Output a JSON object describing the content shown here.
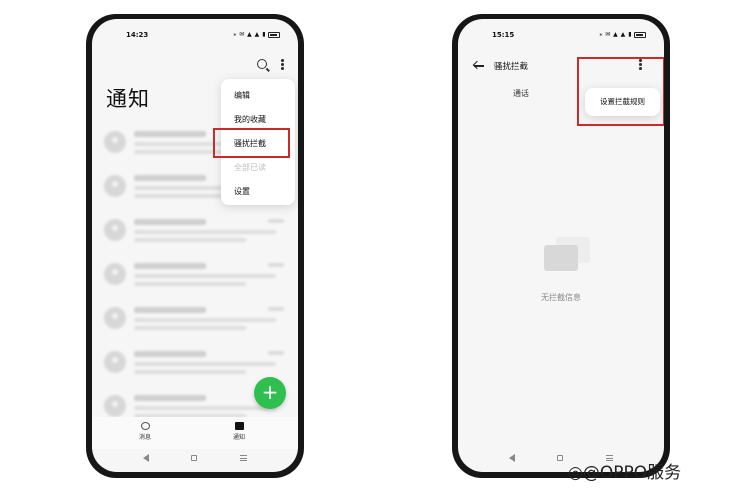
{
  "left_phone": {
    "status_time": "14:23",
    "status_icons": "⁎ ✉ ▲ ▲ ▮",
    "page_title": "通知",
    "menu": {
      "items": [
        {
          "label": "编辑",
          "disabled": false
        },
        {
          "label": "我的收藏",
          "disabled": false
        },
        {
          "label": "骚扰拦截",
          "disabled": false
        },
        {
          "label": "全部已读",
          "disabled": true
        },
        {
          "label": "设置",
          "disabled": false
        }
      ]
    },
    "fab_symbol": "+",
    "bottom_nav": {
      "messages_label": "消息",
      "notice_label": "通知"
    }
  },
  "right_phone": {
    "status_time": "15:15",
    "status_icons": "⁎ ✉ ▲ ▲ ▮",
    "header_title": "骚扰拦截",
    "tab_label": "通话",
    "popup_label": "设置拦截规则",
    "empty_text": "无拦截信息"
  },
  "watermark": "◎@OPPO服务",
  "colors": {
    "highlight": "#c92a2a",
    "fab": "#2fbf4f"
  }
}
